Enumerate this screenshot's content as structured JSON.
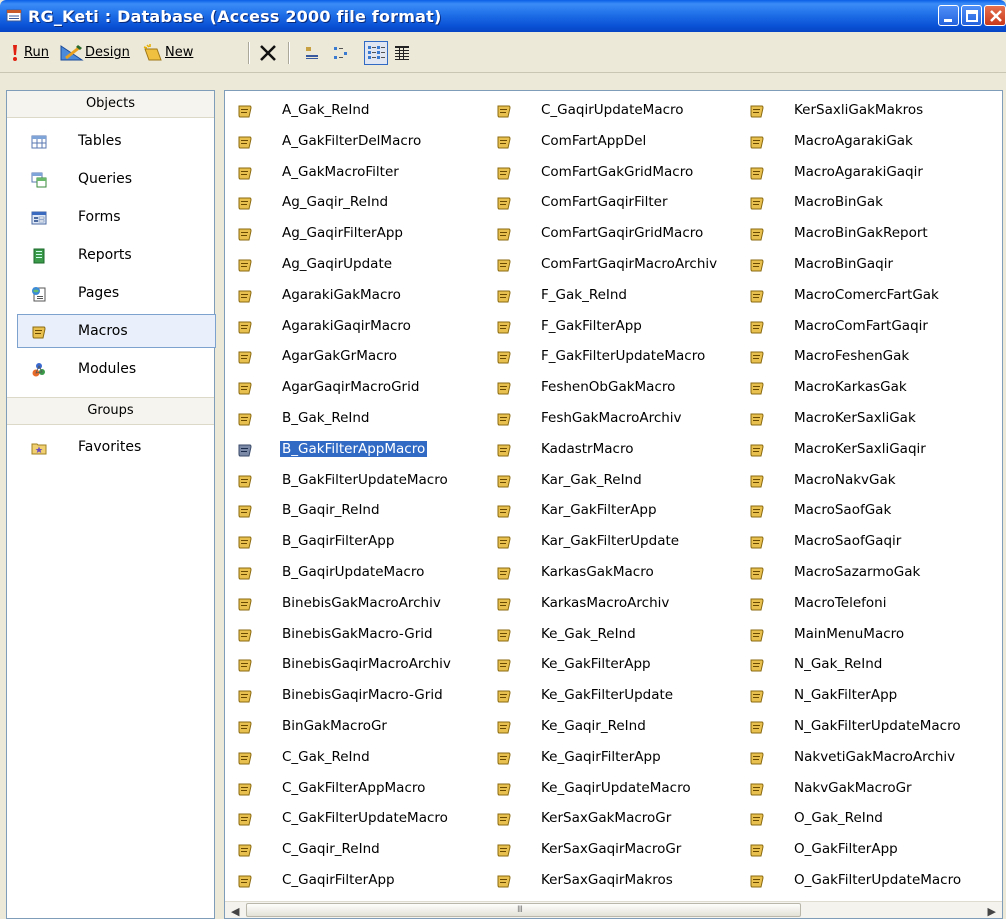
{
  "window": {
    "title": "RG_Keti : Database (Access 2000 file format)",
    "colors": {
      "titlebar": "#0a52d6",
      "selection": "#316ac5"
    }
  },
  "toolbar": {
    "run_label": "Run",
    "design_label": "Design",
    "new_label": "New",
    "icons": [
      "run-icon",
      "design-icon",
      "new-icon",
      "delete-icon",
      "large-icons-view-icon",
      "small-icons-view-icon",
      "list-view-icon",
      "details-view-icon"
    ]
  },
  "objects_pane": {
    "header": "Objects",
    "items": [
      {
        "label": "Tables",
        "icon": "table-icon"
      },
      {
        "label": "Queries",
        "icon": "query-icon"
      },
      {
        "label": "Forms",
        "icon": "form-icon"
      },
      {
        "label": "Reports",
        "icon": "report-icon"
      },
      {
        "label": "Pages",
        "icon": "page-icon"
      },
      {
        "label": "Macros",
        "icon": "macro-icon",
        "selected": true
      },
      {
        "label": "Modules",
        "icon": "module-icon"
      }
    ],
    "groups_header": "Groups",
    "groups": [
      {
        "label": "Favorites",
        "icon": "favorites-icon"
      }
    ]
  },
  "macros": {
    "selected": "B_GakFilterAppMacro",
    "columns": [
      [
        "A_Gak_ReInd",
        "A_GakFilterDelMacro",
        "A_GakMacroFilter",
        "Ag_Gaqir_ReInd",
        "Ag_GaqirFilterApp",
        "Ag_GaqirUpdate",
        "AgarakiGakMacro",
        "AgarakiGaqirMacro",
        "AgarGakGrMacro",
        "AgarGaqirMacroGrid",
        "B_Gak_ReInd",
        "B_GakFilterAppMacro",
        "B_GakFilterUpdateMacro",
        "B_Gaqir_ReInd",
        "B_GaqirFilterApp",
        "B_GaqirUpdateMacro",
        "BinebisGakMacroArchiv",
        "BinebisGakMacro-Grid",
        "BinebisGaqirMacroArchiv",
        "BinebisGaqirMacro-Grid",
        "BinGakMacroGr",
        "C_Gak_ReInd",
        "C_GakFilterAppMacro",
        "C_GakFilterUpdateMacro",
        "C_Gaqir_ReInd",
        "C_GaqirFilterApp"
      ],
      [
        "C_GaqirUpdateMacro",
        "ComFartAppDel",
        "ComFartGakGridMacro",
        "ComFartGaqirFilter",
        "ComFartGaqirGridMacro",
        "ComFartGaqirMacroArchiv",
        "F_Gak_ReInd",
        "F_GakFilterApp",
        "F_GakFilterUpdateMacro",
        "FeshenObGakMacro",
        "FeshGakMacroArchiv",
        "KadastrMacro",
        "Kar_Gak_ReInd",
        "Kar_GakFilterApp",
        "Kar_GakFilterUpdate",
        "KarkasGakMacro",
        "KarkasMacroArchiv",
        "Ke_Gak_ReInd",
        "Ke_GakFilterApp",
        "Ke_GakFilterUpdate",
        "Ke_Gaqir_ReInd",
        "Ke_GaqirFilterApp",
        "Ke_GaqirUpdateMacro",
        "KerSaxGakMacroGr",
        "KerSaxGaqirMacroGr",
        "KerSaxGaqirMakros"
      ],
      [
        "KerSaxliGakMakros",
        "MacroAgarakiGak",
        "MacroAgarakiGaqir",
        "MacroBinGak",
        "MacroBinGakReport",
        "MacroBinGaqir",
        "MacroComercFartGak",
        "MacroComFartGaqir",
        "MacroFeshenGak",
        "MacroKarkasGak",
        "MacroKerSaxliGak",
        "MacroKerSaxliGaqir",
        "MacroNakvGak",
        "MacroSaofGak",
        "MacroSaofGaqir",
        "MacroSazarmoGak",
        "MacroTelefoni",
        "MainMenuMacro",
        "N_Gak_ReInd",
        "N_GakFilterApp",
        "N_GakFilterUpdateMacro",
        "NakvetiGakMacroArchiv",
        "NakvGakMacroGr",
        "O_Gak_ReInd",
        "O_GakFilterApp",
        "O_GakFilterUpdateMacro"
      ]
    ]
  },
  "scrollbar": {
    "grip": "III"
  }
}
